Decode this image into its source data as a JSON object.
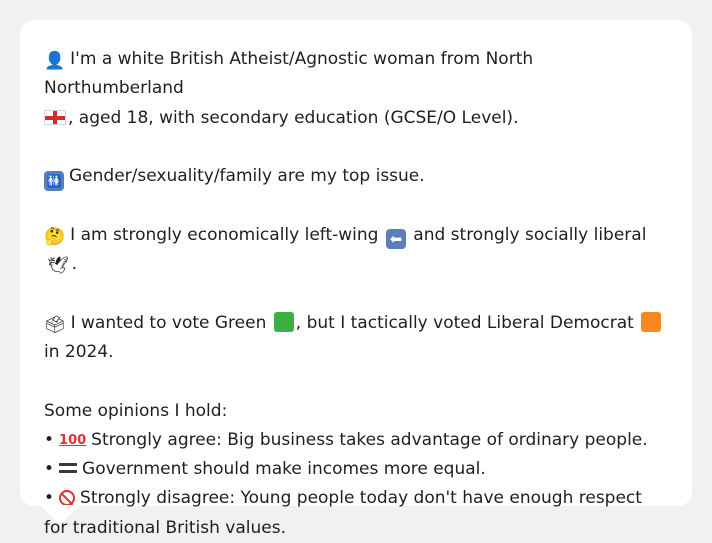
{
  "profile": {
    "identity_text": "I'm a white British Atheist/Agnostic woman from North Northumberland",
    "identity_text_2": ", aged 18, with secondary education (GCSE/O Level).",
    "issue_text": "Gender/sexuality/family are my top issue.",
    "econ_text_1": "I am strongly economically left-wing",
    "econ_text_2": "and strongly socially liberal",
    "econ_text_3": ".",
    "vote_text_1": "I wanted to vote Green",
    "vote_text_2": ", but I tactically voted Liberal Democrat",
    "vote_text_3": "in 2024.",
    "opinions_heading": "Some opinions I hold:",
    "bullet_char": "•",
    "opinions": [
      {
        "icon": "hundred-points-icon",
        "text": "Strongly agree: Big business takes advantage of ordinary people."
      },
      {
        "icon": "equals-icon",
        "text": "Government should make incomes more equal."
      },
      {
        "icon": "no-entry-icon",
        "text": "Strongly disagree: Young people today don't have enough respect for traditional British values."
      }
    ]
  },
  "icons": {
    "person": "bust-silhouette-icon",
    "flag": "england-flag-icon",
    "restroom": "restroom-icon",
    "thinking": "thinking-face-icon",
    "left_arrow": "left-arrow-icon",
    "dove": "dove-icon",
    "ballot": "ballot-box-icon",
    "green": "green-square-icon",
    "orange": "orange-square-icon",
    "hundred_label": "100"
  },
  "colors": {
    "green_party": "#3cb043",
    "lib_dem": "#f5891f",
    "card_bg": "#ffffff",
    "page_bg": "#f1f1f3"
  }
}
